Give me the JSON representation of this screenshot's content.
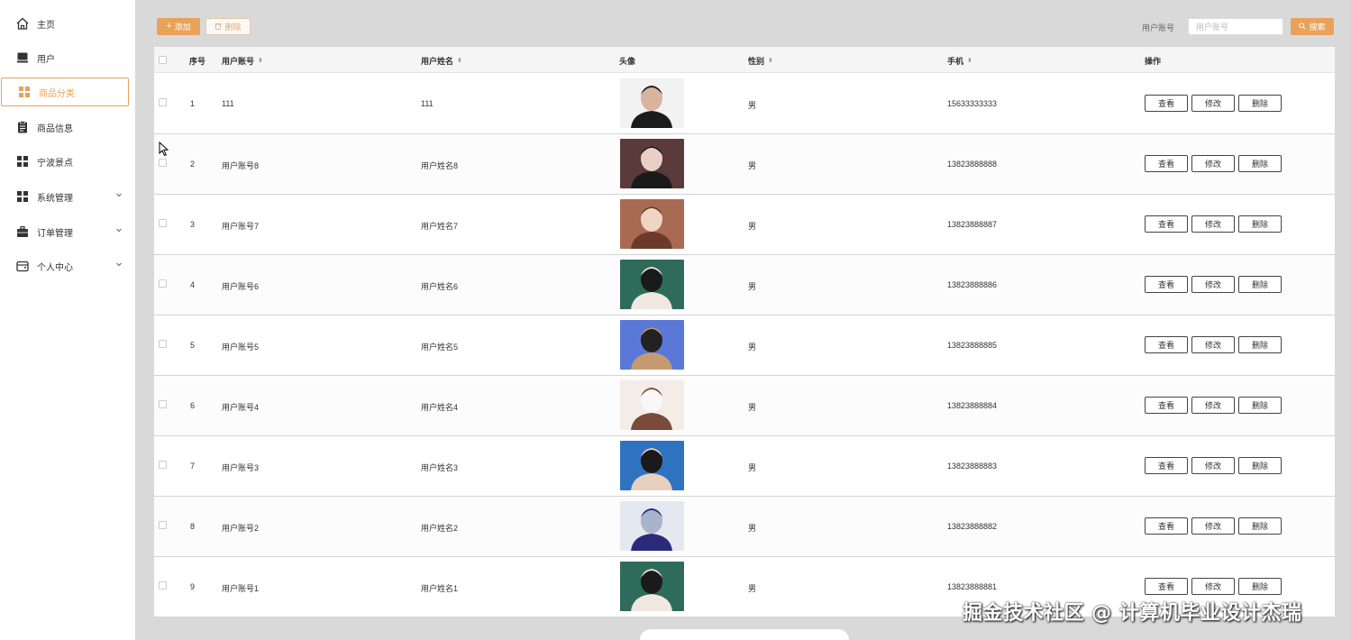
{
  "sidebar": {
    "items": [
      {
        "label": "主页",
        "icon": "home-icon"
      },
      {
        "label": "用户",
        "icon": "user-icon"
      },
      {
        "label": "商品分类",
        "icon": "grid-icon",
        "active": true
      },
      {
        "label": "商品信息",
        "icon": "clipboard-icon"
      },
      {
        "label": "宁波景点",
        "icon": "grid-icon"
      },
      {
        "label": "系统管理",
        "icon": "grid-icon",
        "expandable": true
      },
      {
        "label": "订单管理",
        "icon": "briefcase-icon",
        "expandable": true
      },
      {
        "label": "个人中心",
        "icon": "wallet-icon",
        "expandable": true
      }
    ]
  },
  "toolbar": {
    "add_label": "添加",
    "delete_label": "删除",
    "search_label": "用户账号",
    "search_placeholder": "用户账号",
    "search_button": "搜索"
  },
  "table": {
    "headers": {
      "index": "序号",
      "account": "用户账号",
      "name": "用户姓名",
      "avatar": "头像",
      "gender": "性别",
      "phone": "手机",
      "actions": "操作"
    },
    "action_labels": {
      "view": "查看",
      "edit": "修改",
      "delete": "删除"
    },
    "rows": [
      {
        "index": "1",
        "account": "111",
        "name": "111",
        "gender": "男",
        "phone": "15633333333",
        "avatar_colors": [
          "#f2f2f2",
          "#1c1c1c",
          "#d8b49c"
        ]
      },
      {
        "index": "2",
        "account": "用户账号8",
        "name": "用户姓名8",
        "gender": "男",
        "phone": "13823888888",
        "avatar_colors": [
          "#5a3a3a",
          "#1a1a1a",
          "#e9d0c4"
        ]
      },
      {
        "index": "3",
        "account": "用户账号7",
        "name": "用户姓名7",
        "gender": "男",
        "phone": "13823888887",
        "avatar_colors": [
          "#a86a52",
          "#6b3a2a",
          "#f0d4c4"
        ]
      },
      {
        "index": "4",
        "account": "用户账号6",
        "name": "用户姓名6",
        "gender": "男",
        "phone": "13823888886",
        "avatar_colors": [
          "#2e6b5b",
          "#f0e8e0",
          "#1a1a1a"
        ]
      },
      {
        "index": "5",
        "account": "用户账号5",
        "name": "用户姓名5",
        "gender": "男",
        "phone": "13823888885",
        "avatar_colors": [
          "#5a78d8",
          "#c49a70",
          "#222222"
        ]
      },
      {
        "index": "6",
        "account": "用户账号4",
        "name": "用户姓名4",
        "gender": "男",
        "phone": "13823888884",
        "avatar_colors": [
          "#f4ece6",
          "#7a4a3a",
          "#f8f8f8"
        ]
      },
      {
        "index": "7",
        "account": "用户账号3",
        "name": "用户姓名3",
        "gender": "男",
        "phone": "13823888883",
        "avatar_colors": [
          "#2f73c0",
          "#e8d0c0",
          "#1a1a1a"
        ]
      },
      {
        "index": "8",
        "account": "用户账号2",
        "name": "用户姓名2",
        "gender": "男",
        "phone": "13823888882",
        "avatar_colors": [
          "#e4e8f0",
          "#2a2a7a",
          "#a8b4cc"
        ]
      },
      {
        "index": "9",
        "account": "用户账号1",
        "name": "用户姓名1",
        "gender": "男",
        "phone": "13823888881",
        "avatar_colors": [
          "#2e6b5b",
          "#f0e8e0",
          "#1a1a1a"
        ]
      }
    ]
  },
  "watermark": "掘金技术社区 @ 计算机毕业设计杰瑞",
  "colors": {
    "accent": "#e8a25a",
    "background": "#d9d9d9"
  }
}
